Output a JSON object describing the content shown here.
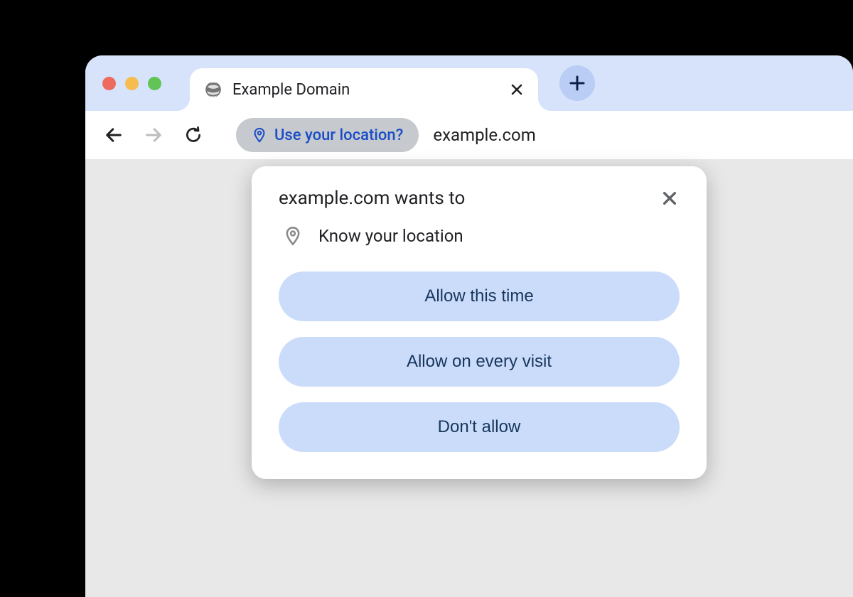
{
  "tab": {
    "title": "Example Domain"
  },
  "address_bar": {
    "permission_chip": "Use your location?",
    "url": "example.com"
  },
  "dialog": {
    "title": "example.com wants to",
    "permission_label": "Know your location",
    "buttons": {
      "allow_once": "Allow this time",
      "allow_always": "Allow on every visit",
      "deny": "Don't allow"
    }
  }
}
